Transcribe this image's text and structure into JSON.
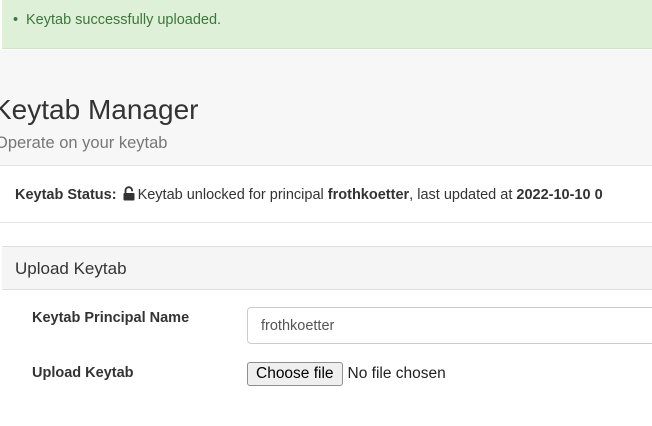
{
  "alert": {
    "items": [
      "Keytab successfully uploaded."
    ],
    "color": "#3c763d",
    "background": "#dff0d8"
  },
  "header": {
    "title": "Keytab Manager",
    "subtitle": "Operate on your keytab"
  },
  "status": {
    "label": "Keytab Status:",
    "icon": "unlocked-padlock-icon",
    "text_before": "Keytab unlocked for principal",
    "principal": "frothkoetter",
    "text_middle": ", last updated at",
    "timestamp": "2022-10-10 0"
  },
  "panel": {
    "title": "Upload Keytab"
  },
  "form": {
    "principal_label": "Keytab Principal Name",
    "principal_value": "frothkoetter",
    "upload_label": "Upload Keytab",
    "file_button_label": "Choose file",
    "file_status": "No file chosen"
  }
}
